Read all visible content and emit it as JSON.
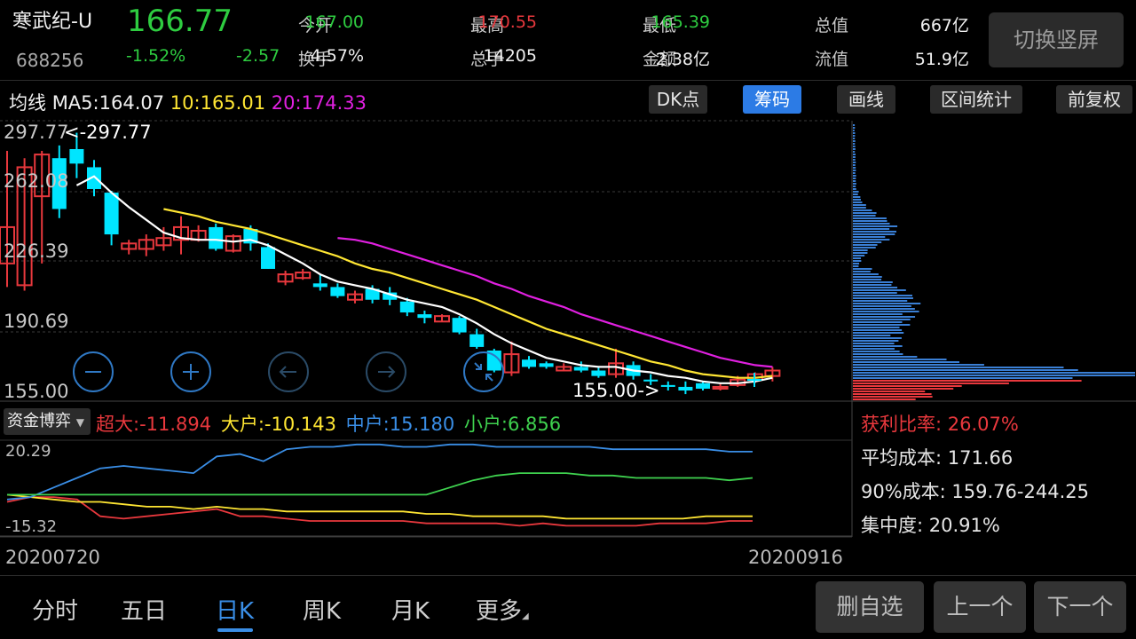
{
  "header": {
    "name": "寒武纪-U",
    "code": "688256",
    "price": "166.77",
    "change_pct": "-1.52%",
    "change_amt": "-2.57",
    "quotes": [
      {
        "label": "今开",
        "value": "167.00",
        "color": "#2ecc40"
      },
      {
        "label": "最高",
        "value": "170.55",
        "color": "#e8383d"
      },
      {
        "label": "最低",
        "value": "165.39",
        "color": "#2ecc40"
      },
      {
        "label": "总值",
        "value": "667亿",
        "color": "#f0f0f0"
      },
      {
        "label": "换手",
        "value": "4.57%",
        "color": "#f0f0f0"
      },
      {
        "label": "总手",
        "value": "14205",
        "color": "#f0f0f0"
      },
      {
        "label": "金额",
        "value": "2.38亿",
        "color": "#f0f0f0"
      },
      {
        "label": "流值",
        "value": "51.9亿",
        "color": "#f0f0f0"
      }
    ],
    "switch_label": "切换竖屏"
  },
  "ma_bar": {
    "title": "均线",
    "ma5": "MA5:164.07",
    "ma10": "10:165.01",
    "ma20": "20:174.33"
  },
  "toolbar": [
    "DK点",
    "筹码",
    "画线",
    "区间统计",
    "前复权"
  ],
  "chart_data": {
    "type": "candlestick",
    "x_start": "20200720",
    "x_end": "20200916",
    "y_ticks": [
      "297.77",
      "262.08",
      "226.39",
      "190.69",
      "155.00"
    ],
    "ylim": [
      155.0,
      297.77
    ],
    "high_marker": "<-297.77",
    "low_marker": "155.00->",
    "candles": [
      [
        225,
        245,
        212,
        287
      ],
      [
        213,
        278,
        210,
        283
      ],
      [
        262,
        285,
        225,
        287
      ],
      [
        283,
        255,
        250,
        290
      ],
      [
        288,
        280,
        272,
        297
      ],
      [
        278,
        266,
        262,
        282
      ],
      [
        264,
        241,
        235,
        265
      ],
      [
        233,
        236,
        230,
        238
      ],
      [
        233,
        238,
        229,
        241
      ],
      [
        235,
        239,
        232,
        245
      ],
      [
        238,
        245,
        230,
        251
      ],
      [
        238,
        243,
        237,
        246
      ],
      [
        245,
        233,
        232,
        247
      ],
      [
        232,
        240,
        231,
        241
      ],
      [
        244,
        236,
        232,
        246
      ],
      [
        234,
        222,
        222,
        236
      ],
      [
        215,
        219,
        213,
        221
      ],
      [
        217,
        220,
        216,
        222
      ],
      [
        214,
        212,
        210,
        219
      ],
      [
        212,
        207,
        206,
        214
      ],
      [
        205,
        208,
        203,
        210
      ],
      [
        211,
        205,
        203,
        213
      ],
      [
        209,
        205,
        202,
        212
      ],
      [
        204,
        198,
        196,
        206
      ],
      [
        197,
        195,
        192,
        199
      ],
      [
        193,
        196,
        193,
        197
      ],
      [
        195,
        187,
        186,
        196
      ],
      [
        186,
        179,
        178,
        189
      ],
      [
        177,
        166,
        165,
        178
      ],
      [
        165,
        175,
        163,
        182
      ],
      [
        172,
        168,
        167,
        174
      ],
      [
        170,
        168,
        167,
        171
      ],
      [
        166,
        168,
        166,
        170
      ],
      [
        168,
        166,
        165,
        171
      ],
      [
        166,
        163,
        162,
        168
      ],
      [
        164,
        170,
        162,
        178
      ],
      [
        169,
        163,
        161,
        171
      ],
      [
        161,
        160,
        158,
        164
      ],
      [
        158,
        157,
        155,
        160
      ],
      [
        157,
        155,
        153,
        160
      ],
      [
        159,
        156,
        155,
        160
      ],
      [
        156,
        157,
        155,
        159
      ],
      [
        158,
        161,
        157,
        163
      ],
      [
        161,
        164,
        159,
        165
      ],
      [
        163,
        166,
        160,
        168
      ]
    ],
    "ma_series": [
      {
        "name": "MA5",
        "color": "#ffffff",
        "values": [
          null,
          null,
          null,
          null,
          268,
          273,
          264,
          256,
          249,
          242,
          239,
          238,
          238,
          237,
          238,
          235,
          230,
          225,
          219,
          215,
          213,
          211,
          208,
          205,
          203,
          201,
          197,
          192,
          186,
          181,
          177,
          173,
          171,
          169,
          168,
          168,
          166,
          165,
          163,
          162,
          160,
          159,
          159,
          160,
          162
        ]
      },
      {
        "name": "MA10",
        "color": "#ffe633",
        "values": [
          null,
          null,
          null,
          null,
          null,
          null,
          null,
          null,
          null,
          255,
          253,
          251,
          248,
          246,
          244,
          241,
          238,
          235,
          232,
          229,
          225,
          222,
          220,
          217,
          214,
          211,
          208,
          205,
          201,
          197,
          193,
          189,
          186,
          183,
          180,
          177,
          174,
          171,
          169,
          166,
          164,
          163,
          162,
          162,
          163
        ]
      },
      {
        "name": "MA20",
        "color": "#e020e0",
        "values": [
          null,
          null,
          null,
          null,
          null,
          null,
          null,
          null,
          null,
          null,
          null,
          null,
          null,
          null,
          null,
          null,
          null,
          null,
          null,
          239,
          238,
          236,
          233,
          230,
          227,
          224,
          221,
          218,
          214,
          211,
          207,
          204,
          201,
          197,
          194,
          191,
          188,
          185,
          182,
          179,
          176,
          173,
          171,
          169,
          168
        ]
      }
    ],
    "fund_bar": {
      "dropdown": "资金博弈",
      "items": [
        {
          "label": "超大:-11.894",
          "color": "#e8383d"
        },
        {
          "label": "大户:-10.143",
          "color": "#ffe633"
        },
        {
          "label": "中户:15.180",
          "color": "#3a8ee6"
        },
        {
          "label": "小户:6.856",
          "color": "#3fd24f"
        }
      ]
    },
    "fund_axis": {
      "top": "20.29",
      "bottom": "-15.32",
      "ylim": [
        -15.32,
        20.29
      ]
    },
    "fund_series": [
      {
        "name": "超大",
        "color": "#e8383d",
        "values": [
          -4,
          -2,
          -2,
          -3,
          -10,
          -11,
          -10,
          -9,
          -8,
          -7,
          -10,
          -10,
          -11,
          -12,
          -12,
          -12,
          -12,
          -12,
          -13,
          -13,
          -13,
          -13,
          -14,
          -13,
          -14,
          -14,
          -14,
          -14,
          -13,
          -13,
          -13,
          -12,
          -12
        ]
      },
      {
        "name": "大户",
        "color": "#ffe633",
        "values": [
          -1,
          -2,
          -3,
          -4,
          -4,
          -5,
          -6,
          -6,
          -7,
          -6,
          -7,
          -7,
          -8,
          -8,
          -8,
          -8,
          -8,
          -8,
          -9,
          -9,
          -10,
          -10,
          -10,
          -10,
          -11,
          -11,
          -11,
          -11,
          -11,
          -11,
          -10,
          -10,
          -10
        ]
      },
      {
        "name": "中户",
        "color": "#3a8ee6",
        "values": [
          -3,
          -2,
          2,
          6,
          10,
          11,
          10,
          9,
          8,
          15,
          16,
          13,
          18,
          19,
          19,
          20,
          20,
          19,
          19,
          20,
          20,
          19,
          19,
          19,
          19,
          19,
          18,
          18,
          18,
          18,
          18,
          17,
          17
        ]
      },
      {
        "name": "小户",
        "color": "#3fd24f",
        "values": [
          -1,
          -1,
          -1,
          -1,
          -1,
          -1,
          -1,
          -1,
          -1,
          -1,
          -1,
          -1,
          -1,
          -1,
          -1,
          -1,
          -1,
          -1,
          -1,
          2,
          5,
          7,
          8,
          8,
          8,
          7,
          7,
          6,
          6,
          6,
          6,
          5,
          6
        ]
      }
    ],
    "chip_stats": {
      "profit_ratio": "获利比率: 26.07%",
      "avg_cost": "平均成本: 171.66",
      "cost90": "90%成本: 159.76-244.25",
      "concentration": "集中度: 20.91%"
    }
  },
  "bottom_tabs": [
    "分时",
    "五日",
    "日K",
    "周K",
    "月K",
    "更多"
  ],
  "bottom_buttons": [
    "删自选",
    "上一个",
    "下一个"
  ],
  "colors": {
    "up": "#e8383d",
    "down": "#00e5ff",
    "accent": "#2c7be5"
  }
}
